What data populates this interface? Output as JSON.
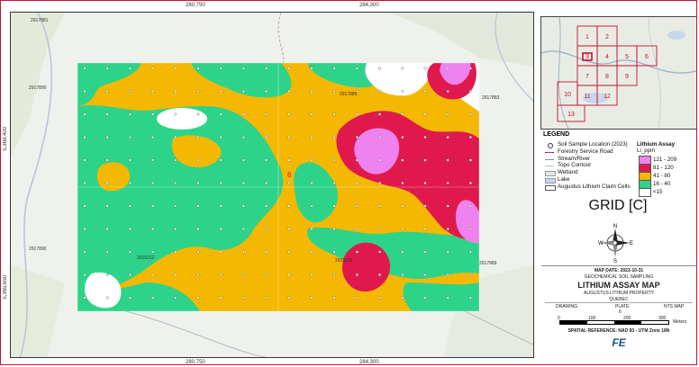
{
  "grid_coords": {
    "top_x1": "280,750",
    "top_x2": "284,300",
    "bottom_x1": "280,750",
    "bottom_x2": "284,300",
    "left_y1": "5,368,400",
    "left_y2": "5,365,650"
  },
  "claim_labels": {
    "c1": "2917881",
    "c2": "2917889",
    "c3": "2917890",
    "c4": "2915212",
    "c5": "2915213",
    "c6": "2917883",
    "c7": "2917889"
  },
  "map_cell_label": "6",
  "legend": {
    "title": "LEGEND",
    "items": [
      "Soil Sample Location (2023)",
      "Forestry Service Road",
      "Stream/River",
      "Topo Contour",
      "Wetland",
      "Lake",
      "Augustus Lithium Claim Cells"
    ],
    "assay_title": "Lithium Assay",
    "assay_unit": "Li_ppm",
    "assay_classes": [
      {
        "label": "121 - 209",
        "color": "#ee82ee"
      },
      {
        "label": "81 - 120",
        "color": "#e0194d"
      },
      {
        "label": "41 - 80",
        "color": "#f5b800"
      },
      {
        "label": "16 - 40",
        "color": "#2ed38a"
      },
      {
        "label": "<15",
        "color": "#ffffff"
      }
    ]
  },
  "grid_title": "GRID [C]",
  "compass": {
    "n": "N",
    "s": "S",
    "e": "E",
    "w": "W"
  },
  "title_block": {
    "date": "MAP DATE: 2023-10-31",
    "subtitle": "GEOCHEMICAL SOIL SAMPLING",
    "main_title": "LITHIUM ASSAY MAP",
    "property": "AUGUSTUS LITHIUM PROPERTY",
    "province": "QUEBEC",
    "drawing_label": "DRAWING",
    "plate_label": "PLATE",
    "plate_value": "6",
    "nts_label": "NTS MAP",
    "scale_0": "0",
    "scale_1": "100",
    "scale_2": "200",
    "scale_3": "300",
    "scale_unit": "Meters",
    "spatial_ref": "SPATIAL REFERENCE: NAD 83 - UTM Zone 18N",
    "logo": "FE"
  },
  "inset_cells": [
    "1",
    "2",
    "3",
    "4",
    "5",
    "6",
    "7",
    "8",
    "9",
    "10",
    "11",
    "12",
    "13"
  ],
  "colors": {
    "pink": "#ee82ee",
    "red": "#e0194d",
    "yellow": "#f5b800",
    "green": "#2ed38a",
    "frame_red": "#c8102e"
  }
}
